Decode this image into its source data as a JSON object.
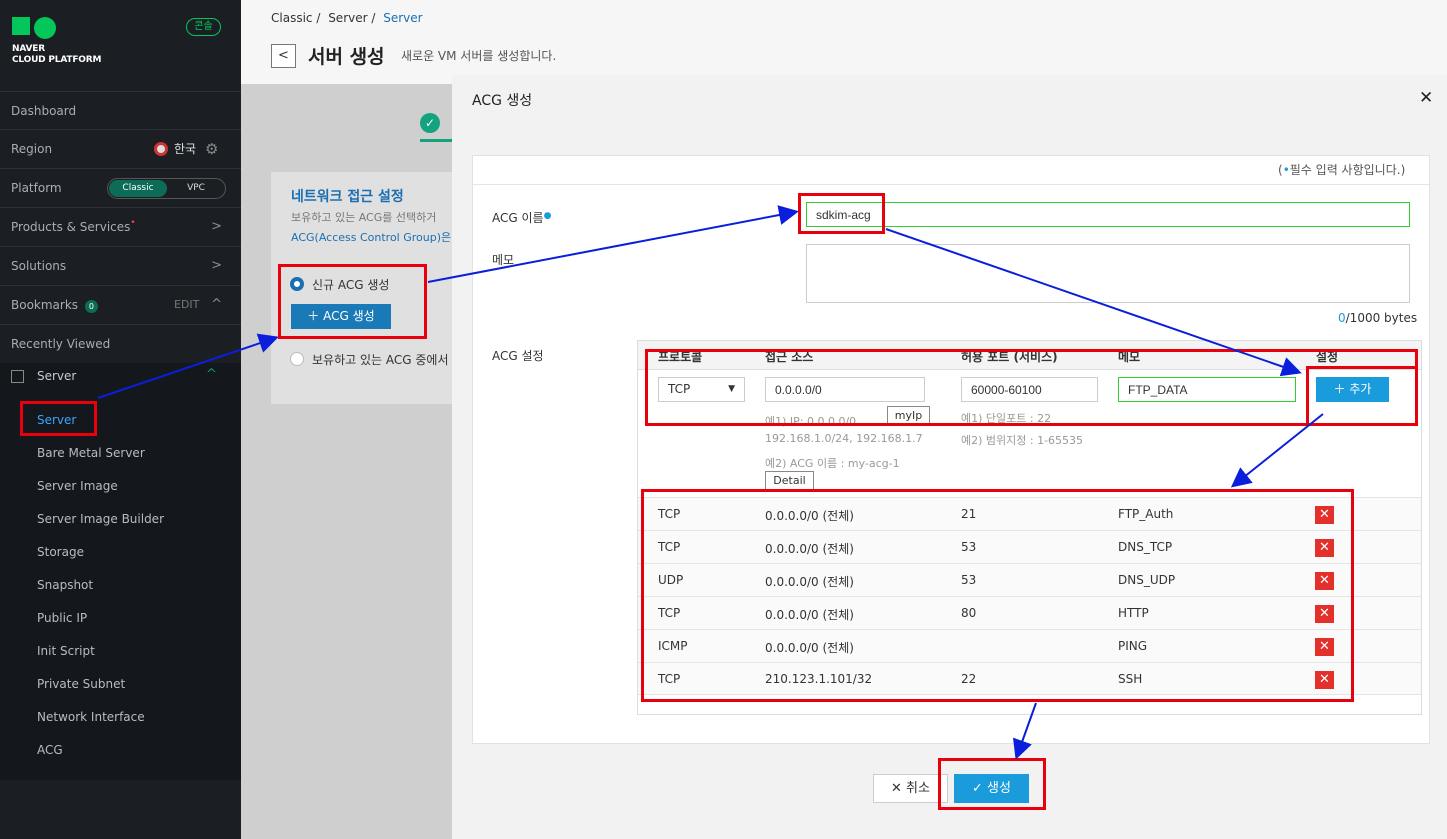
{
  "sidebar": {
    "logo_line1": "NAVER",
    "logo_line2": "CLOUD PLATFORM",
    "console": "콘솔",
    "dashboard": "Dashboard",
    "region": "Region",
    "region_value": "한국",
    "platform": "Platform",
    "platform_classic": "Classic",
    "platform_vpc": "VPC",
    "products": "Products & Services",
    "solutions": "Solutions",
    "bookmarks": "Bookmarks",
    "bookmarks_count": "0",
    "edit": "EDIT",
    "recent": "Recently Viewed",
    "server_section": "Server",
    "sub_items": [
      "Server",
      "Bare Metal Server",
      "Server Image",
      "Server Image Builder",
      "Storage",
      "Snapshot",
      "Public IP",
      "Init Script",
      "Private Subnet",
      "Network Interface",
      "ACG"
    ]
  },
  "header": {
    "crumb1": "Classic /",
    "crumb2": "Server /",
    "crumb3": "Server",
    "title": "서버 생성",
    "desc": "새로운 VM 서버를 생성합니다."
  },
  "panel": {
    "title": "네트워크 접근 설정",
    "desc1": "보유하고 있는 ACG를 선택하거",
    "desc2": "ACG(Access Control Group)은",
    "opt_new": "신규 ACG 생성",
    "btn_acg": "ACG 생성",
    "opt_existing": "보유하고 있는 ACG 중에서"
  },
  "modal": {
    "title": "ACG 생성",
    "required_note": "필수 입력 사항입니다.",
    "name_label": "ACG 이름",
    "name_value": "sdkim-acg",
    "memo_label": "메모",
    "memo_count": "0",
    "memo_limit": "/1000 bytes",
    "settings_label": "ACG 설정",
    "col_protocol": "프로토콜",
    "col_source": "접근 소스",
    "col_port": "허용 포트 (서비스)",
    "col_memo": "메모",
    "col_setting": "설정",
    "protocol_value": "TCP",
    "source_value": "0.0.0.0/0",
    "port_value": "60000-60100",
    "memo_value": "FTP_DATA",
    "myip": "myIp",
    "add": "추가",
    "hint_src1": "예1) IP: 0.0.0.0/0",
    "hint_src2": "192.168.1.0/24, 192.168.1.7",
    "hint_src3": "예2) ACG 이름 : my-acg-1",
    "detail": "Detail",
    "hint_port1": "예1) 단일포트 : 22",
    "hint_port2": "예2) 범위지정 : 1-65535",
    "rules": [
      {
        "protocol": "TCP",
        "source": "0.0.0.0/0 (전체)",
        "port": "21",
        "memo": "FTP_Auth"
      },
      {
        "protocol": "TCP",
        "source": "0.0.0.0/0 (전체)",
        "port": "53",
        "memo": "DNS_TCP"
      },
      {
        "protocol": "UDP",
        "source": "0.0.0.0/0 (전체)",
        "port": "53",
        "memo": "DNS_UDP"
      },
      {
        "protocol": "TCP",
        "source": "0.0.0.0/0 (전체)",
        "port": "80",
        "memo": "HTTP"
      },
      {
        "protocol": "ICMP",
        "source": "0.0.0.0/0 (전체)",
        "port": "",
        "memo": "PING"
      },
      {
        "protocol": "TCP",
        "source": "210.123.1.101/32",
        "port": "22",
        "memo": "SSH"
      }
    ],
    "cancel": "취소",
    "create": "생성"
  },
  "colors": {
    "accent": "#1a9bdc",
    "brand": "#03c75a",
    "annotation_red": "#e8000c",
    "annotation_arrow": "#0a1edc"
  }
}
